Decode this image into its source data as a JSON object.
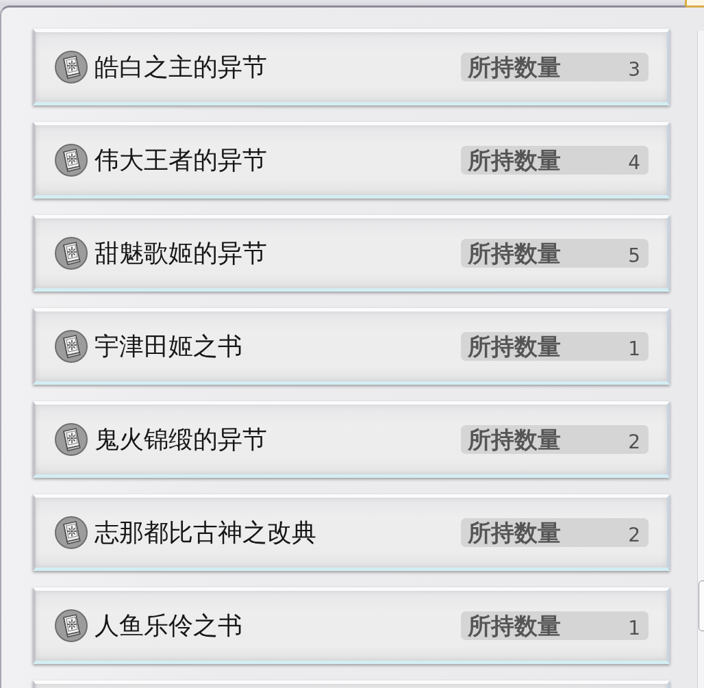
{
  "items": [
    {
      "name": "皓白之主的异节",
      "quantity_label": "所持数量",
      "quantity": "3"
    },
    {
      "name": "伟大王者的异节",
      "quantity_label": "所持数量",
      "quantity": "4"
    },
    {
      "name": "甜魅歌姬的异节",
      "quantity_label": "所持数量",
      "quantity": "5"
    },
    {
      "name": "宇津田姬之书",
      "quantity_label": "所持数量",
      "quantity": "1"
    },
    {
      "name": "鬼火锦缎的异节",
      "quantity_label": "所持数量",
      "quantity": "2"
    },
    {
      "name": "志那都比古神之改典",
      "quantity_label": "所持数量",
      "quantity": "2"
    },
    {
      "name": "人鱼乐伶之书",
      "quantity_label": "所持数量",
      "quantity": "1"
    }
  ],
  "more_items_below": true
}
